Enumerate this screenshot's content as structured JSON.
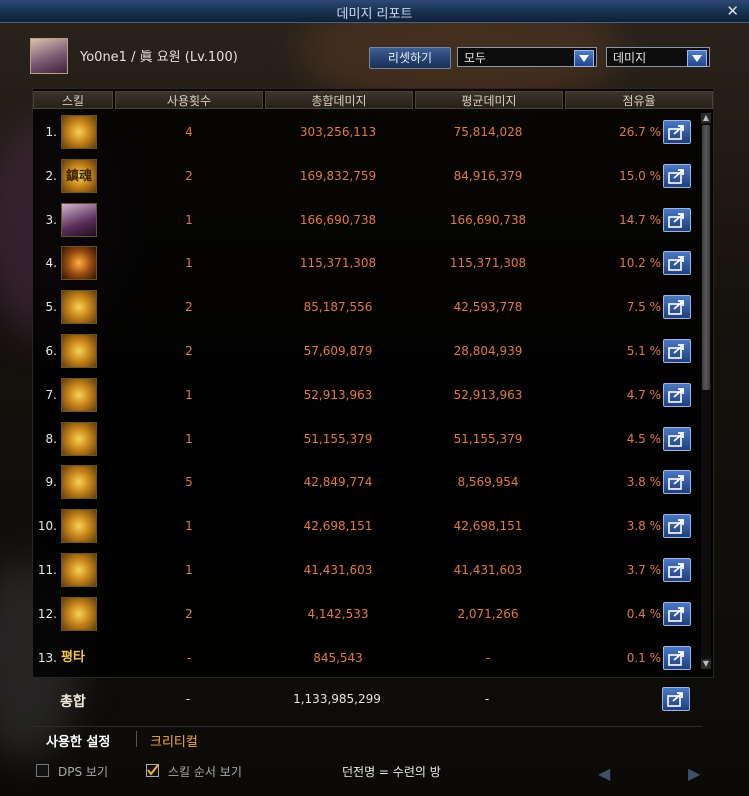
{
  "window": {
    "title": "데미지 리포트",
    "close_glyph": "✕"
  },
  "header": {
    "player": "Yo0ne1 / 眞 요원 (Lv.100)",
    "reset_label": "리셋하기",
    "filter_target": "모두",
    "filter_metric": "데미지"
  },
  "columns": [
    "스킬",
    "사용횟수",
    "총합데미지",
    "평균데미지",
    "점유율"
  ],
  "rows": [
    {
      "rank": "1.",
      "count": "4",
      "total": "303,256,113",
      "avg": "75,814,028",
      "pct": "26.7 %"
    },
    {
      "rank": "2.",
      "count": "2",
      "total": "169,832,759",
      "avg": "84,916,379",
      "pct": "15.0 %",
      "icon_text": "鎮魂"
    },
    {
      "rank": "3.",
      "count": "1",
      "total": "166,690,738",
      "avg": "166,690,738",
      "pct": "14.7 %"
    },
    {
      "rank": "4.",
      "count": "1",
      "total": "115,371,308",
      "avg": "115,371,308",
      "pct": "10.2 %"
    },
    {
      "rank": "5.",
      "count": "2",
      "total": "85,187,556",
      "avg": "42,593,778",
      "pct": "7.5 %"
    },
    {
      "rank": "6.",
      "count": "2",
      "total": "57,609,879",
      "avg": "28,804,939",
      "pct": "5.1 %"
    },
    {
      "rank": "7.",
      "count": "1",
      "total": "52,913,963",
      "avg": "52,913,963",
      "pct": "4.7 %"
    },
    {
      "rank": "8.",
      "count": "1",
      "total": "51,155,379",
      "avg": "51,155,379",
      "pct": "4.5 %"
    },
    {
      "rank": "9.",
      "count": "5",
      "total": "42,849,774",
      "avg": "8,569,954",
      "pct": "3.8 %"
    },
    {
      "rank": "10.",
      "count": "1",
      "total": "42,698,151",
      "avg": "42,698,151",
      "pct": "3.8 %"
    },
    {
      "rank": "11.",
      "count": "1",
      "total": "41,431,603",
      "avg": "41,431,603",
      "pct": "3.7 %"
    },
    {
      "rank": "12.",
      "count": "2",
      "total": "4,142,533",
      "avg": "2,071,266",
      "pct": "0.4 %"
    },
    {
      "rank": "13.",
      "count": "-",
      "total": "845,543",
      "avg": "-",
      "pct": "0.1 %",
      "icon_text": "평타"
    }
  ],
  "total": {
    "label": "총합",
    "count": "-",
    "total": "1,133,985,299",
    "avg": "-"
  },
  "tabs": {
    "used": "사용한 설정",
    "critical": "크리티컬"
  },
  "footer": {
    "dps_label": "DPS 보기",
    "dps_checked": false,
    "skill_order_label": "스킬 순서 보기",
    "skill_order_checked": true,
    "dungeon": "던전명 = 수련의 방"
  },
  "colors": {
    "value": "#e07a3e",
    "accent_tab": "#f7a83a",
    "title_bar": "#1f3d66"
  }
}
